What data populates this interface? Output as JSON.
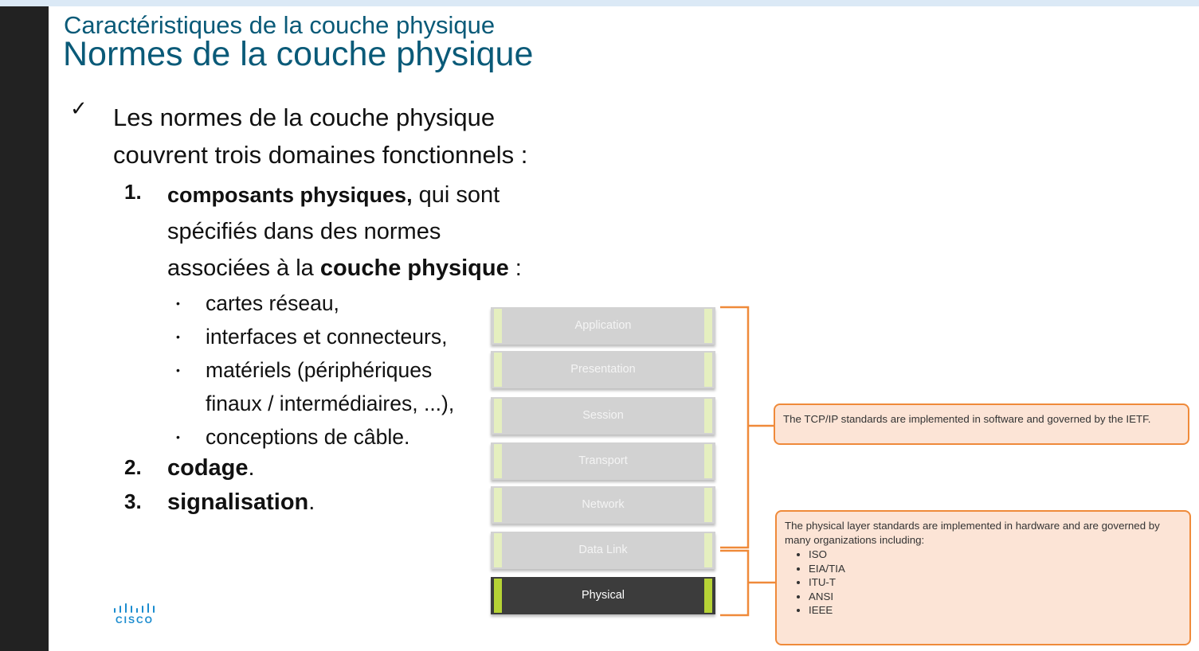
{
  "header": {
    "subtitle": "Caractéristiques de la couche physique",
    "title": "Normes de la couche physique"
  },
  "content": {
    "check_symbol": "✓",
    "intro_line1": "Les normes de la couche physique",
    "intro_line2": "couvrent trois domaines fonctionnels :",
    "item1": {
      "number": "1.",
      "bold": "composants physiques,",
      "line1_rest": " qui sont",
      "line2": "spécifiés dans des normes",
      "line3_pre": "associées à la ",
      "line3_bold": "couche physique",
      "line3_post": " :"
    },
    "sub_items": [
      "cartes réseau,",
      "interfaces et connecteurs,",
      "matériels (périphériques",
      "finaux / intermédiaires, ...),",
      "conceptions de câble."
    ],
    "bullet_symbol": "•",
    "item2": {
      "number": "2.",
      "bold": "codage",
      "post": "."
    },
    "item3": {
      "number": "3.",
      "bold": "signalisation",
      "post": "."
    }
  },
  "diagram": {
    "layers": [
      "Application",
      "Presentation",
      "Session",
      "Transport",
      "Network",
      "Data Link",
      "Physical"
    ],
    "callout_tcpip": "The TCP/IP standards are implemented in software and governed by the IETF.",
    "callout_physical": "The physical layer standards are implemented in hardware and are governed by many organizations including:",
    "organizations": [
      "ISO",
      "EIA/TIA",
      "ITU-T",
      "ANSI",
      "IEEE"
    ]
  },
  "logo": {
    "text": "CISCO"
  },
  "colors": {
    "title": "#0a5a78",
    "accent_orange": "#ef8a3a",
    "callout_fill": "#fce4d6",
    "layer_gray": "#d2d2d2",
    "physical_dark": "#3c3c3c",
    "physical_edge": "#b6d335",
    "cisco_blue": "#1b8ccf"
  }
}
